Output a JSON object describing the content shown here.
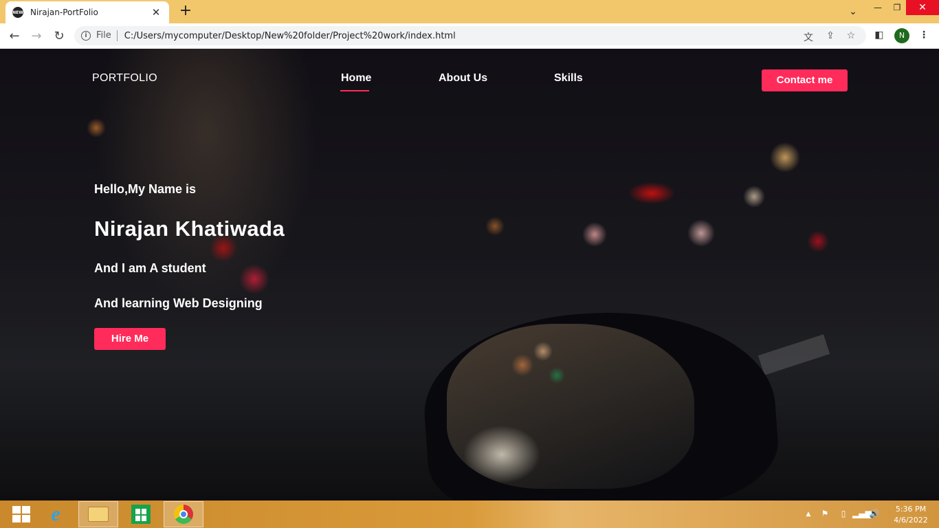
{
  "browser": {
    "tab_title": "Nirajan-PortFolio",
    "tab_favicon": "NEW",
    "new_tab": "+",
    "close_tab": "✕",
    "omnibox": {
      "scheme_label": "File",
      "url": "C:/Users/mycomputer/Desktop/New%20folder/Project%20work/index.html"
    },
    "profile_initial": "N",
    "accent_color": "#f2c66b"
  },
  "page": {
    "nav": {
      "logo": "PORTFOLIO",
      "links": [
        "Home",
        "About Us",
        "Skills"
      ],
      "active": "Home",
      "contact_label": "Contact me"
    },
    "hero": {
      "greeting": "Hello,My Name is",
      "name": "Nirajan Khatiwada",
      "tagline_1": "And I am A student",
      "tagline_2": "And learning Web Designing",
      "cta_label": "Hire Me"
    },
    "accent_color": "#ff2b5a"
  },
  "taskbar": {
    "pinned": [
      "internet-explorer-icon",
      "file-explorer-icon",
      "store-icon",
      "chrome-icon"
    ],
    "clock": {
      "time": "5:36 PM",
      "date": "4/6/2022"
    }
  }
}
